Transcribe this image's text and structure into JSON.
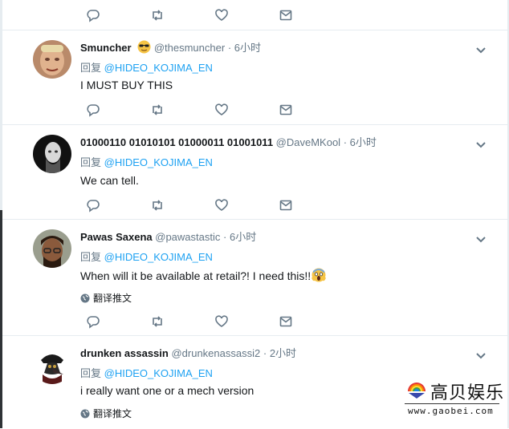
{
  "tweets": [
    {
      "name": "Smuncher",
      "emoji": "sunglasses-emoji",
      "handle": "@thesmuncher",
      "sep": "·",
      "time": "6小时",
      "reply_label": "回复",
      "mention": "@HIDEO_KOJIMA_EN",
      "text": "I MUST BUY THIS"
    },
    {
      "name": "01000110 01010101 01000011 01001011",
      "handle": "@DaveMKool",
      "sep": "·",
      "time": "6小时",
      "reply_label": "回复",
      "mention": "@HIDEO_KOJIMA_EN",
      "text": "We can tell."
    },
    {
      "name": "Pawas Saxena",
      "handle": "@pawastastic",
      "sep": "·",
      "time": "6小时",
      "reply_label": "回复",
      "mention": "@HIDEO_KOJIMA_EN",
      "text": "When will it be available at retail?! I need this!!",
      "emoji": "scream-emoji",
      "translate": "翻译推文"
    },
    {
      "name": "drunken assassin",
      "handle": "@drunkenassassi2",
      "sep": "·",
      "time": "2小时",
      "reply_label": "回复",
      "mention": "@HIDEO_KOJIMA_EN",
      "text": "i really want one or a mech version",
      "translate": "翻译推文"
    }
  ],
  "action_icons": [
    "reply-icon",
    "retweet-icon",
    "like-icon",
    "message-icon"
  ],
  "watermark": {
    "brand": "高贝娱乐",
    "url": "www.gaobei.com"
  },
  "colors": {
    "link": "#1da1f2",
    "muted": "#657786",
    "text": "#14171a",
    "divider": "#e6ecf0"
  }
}
